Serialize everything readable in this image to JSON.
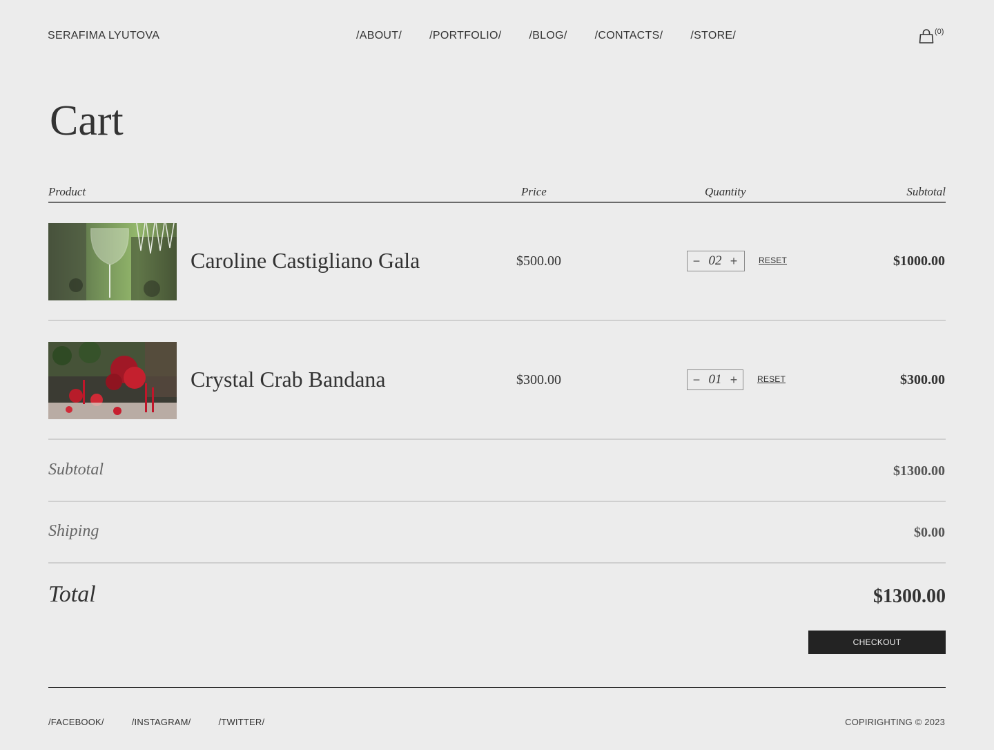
{
  "header": {
    "brand": "SERAFIMA LYUTOVA",
    "nav": [
      "/ABOUT/",
      "/PORTFOLIO/",
      "/BLOG/",
      "/CONTACTS/",
      "/STORE/"
    ],
    "cart_count": "(0)",
    "cart_icon": "shopping-bag-icon"
  },
  "page_title": "Cart",
  "table": {
    "headers": {
      "product": "Product",
      "price": "Price",
      "quantity": "Quantity",
      "subtotal": "Subtotal"
    },
    "items": [
      {
        "name": "Caroline Castigliano Gala",
        "price": "$500.00",
        "quantity": "02",
        "reset": "RESET",
        "subtotal": "$1000.00"
      },
      {
        "name": "Crystal Crab Bandana",
        "price": "$300.00",
        "quantity": "01",
        "reset": "RESET",
        "subtotal": "$300.00"
      }
    ],
    "minus_icon": "minus-icon",
    "plus_icon": "plus-icon"
  },
  "summary": {
    "subtotal_label": "Subtotal",
    "subtotal_value": "$1300.00",
    "shipping_label": "Shiping",
    "shipping_value": "$0.00",
    "total_label": "Total",
    "total_value": "$1300.00",
    "checkout_label": "CHECKOUT"
  },
  "footer": {
    "social": [
      "/FACEBOOK/",
      "/INSTAGRAM/",
      "/TWITTER/"
    ],
    "copyright": "COPIRIGHTING © 2023"
  }
}
